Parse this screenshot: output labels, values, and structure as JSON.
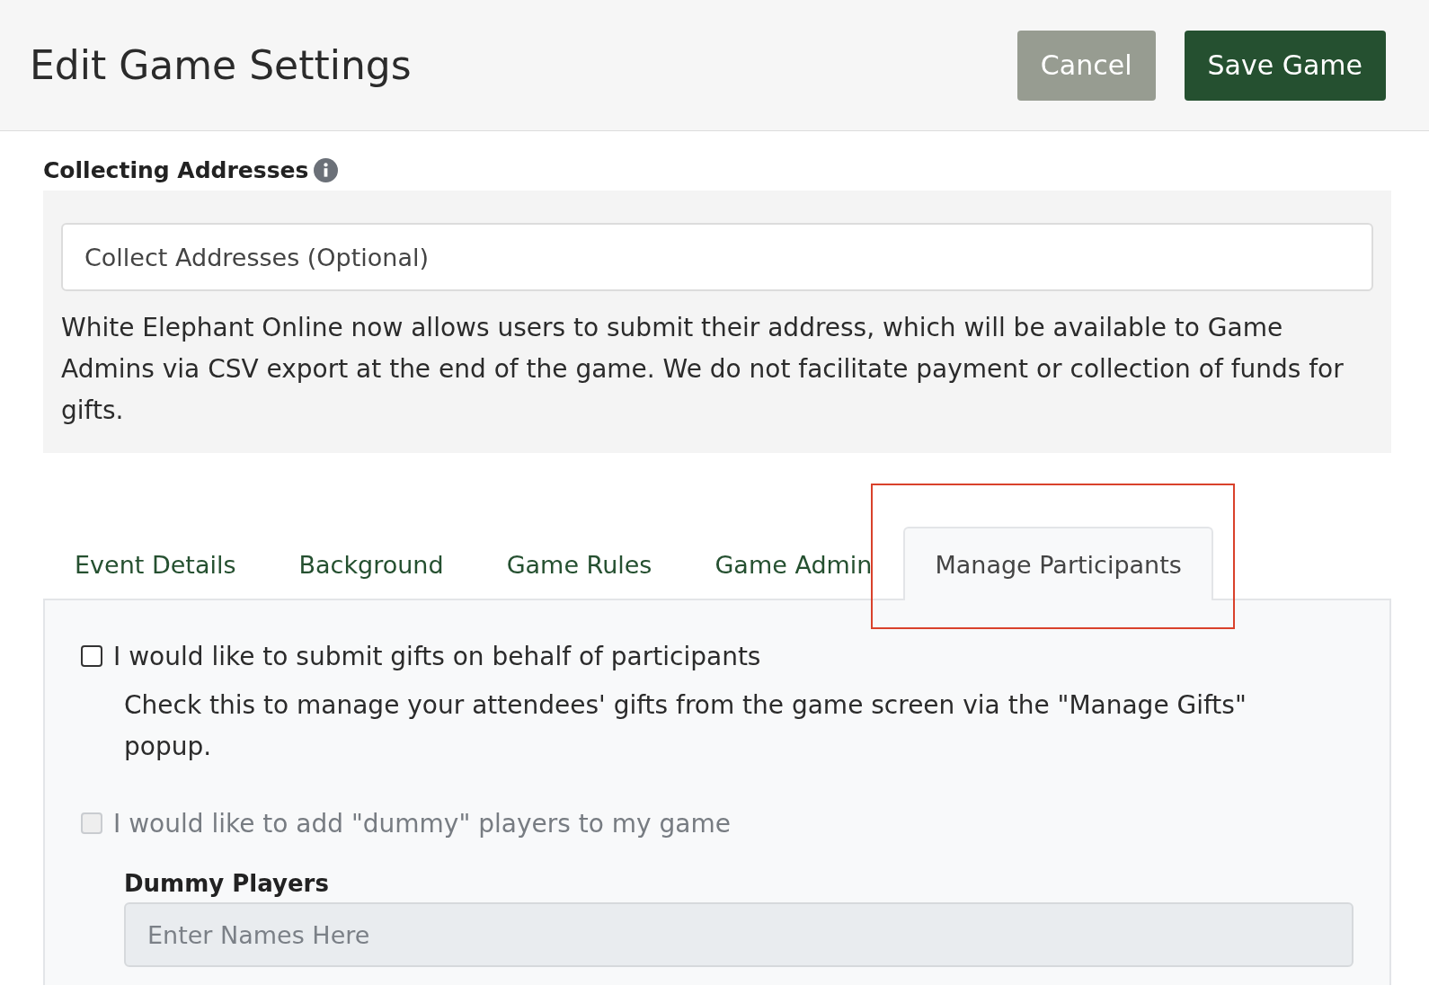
{
  "header": {
    "title": "Edit Game Settings",
    "buttons": [
      {
        "label": "Cancel",
        "kind": "secondary"
      },
      {
        "label": "Save Game",
        "kind": "primary"
      }
    ]
  },
  "addresses": {
    "label": "Collecting Addresses",
    "field": {
      "value": "Collect Addresses (Optional)"
    },
    "description": "White Elephant Online now allows users to submit their address, which will be available to Game Admins via CSV export at the end of the game. We do not facilitate payment or collection of funds for gifts."
  },
  "tabs": [
    {
      "label": "Event Details",
      "selected": false,
      "highlighted": false
    },
    {
      "label": "Background",
      "selected": false,
      "highlighted": false
    },
    {
      "label": "Game Rules",
      "selected": false,
      "highlighted": false
    },
    {
      "label": "Game Admin",
      "selected": false,
      "highlighted": false
    },
    {
      "label": "Manage Participants",
      "selected": true,
      "highlighted": true
    }
  ],
  "options": [
    {
      "label": "I would like to submit gifts on behalf of participants",
      "checked": false,
      "disabled": false,
      "help": "Check this to manage your attendees' gifts from the game screen via the \"Manage Gifts\" popup."
    },
    {
      "label": "I would like to add \"dummy\" players to my game",
      "checked": false,
      "disabled": true
    }
  ],
  "dummy_players": {
    "label": "Dummy Players",
    "placeholder": "Enter Names Here",
    "disabled": true
  }
}
